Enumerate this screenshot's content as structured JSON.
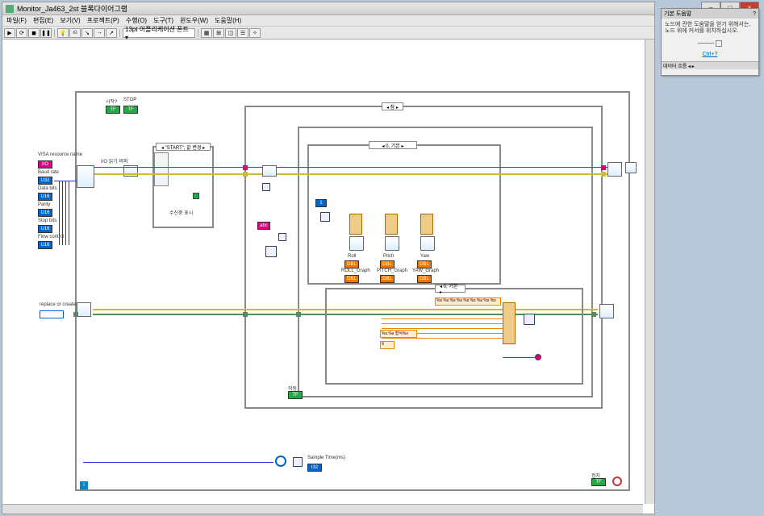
{
  "window": {
    "title": "Monitor_Ja463_2st 블록다이어그램"
  },
  "menu": [
    "파일(F)",
    "편집(E)",
    "보기(V)",
    "프로젝트(P)",
    "수행(O)",
    "도구(T)",
    "윈도우(W)",
    "도움말(H)"
  ],
  "fontselector": "13pt 어플리케이션 폰트 ▾",
  "help_panel": {
    "title": "기본 도움말",
    "line1": "노드에 관한 도움말을 얻기 위해서는,",
    "line2": "노드 위에 커서를 위치하십시오.",
    "morelink": "Ctrl+?"
  },
  "winbuttons": {
    "min": "–",
    "max": "□",
    "close": "×"
  },
  "labels": {
    "visa": "VISA resource name",
    "baud": "Baud rate",
    "databits": "Data bits",
    "parity": "Parity",
    "stopbits": "Stop bits",
    "flow": "Flow control",
    "start": "시작?",
    "stop": "STOP",
    "readbuf": "I/O 읽기 버퍼",
    "case_start": "◂  \"START\", 값 변경  ▸",
    "case_true": "◂  참  ▸",
    "case_default": "◂  0, 기본  ▸",
    "subtitle": "수신중 표시",
    "sampletime": "Sample Time(ms)",
    "roll": "Roll",
    "pitch": "Pitch",
    "yaw": "Yaw",
    "rollg": "ROLL_Graph",
    "pitchg": "PITCH_Graph",
    "yawg": "YAW_Graph",
    "replace": "replace or create",
    "running": "작동",
    "stopbtn": "정지",
    "fmt": "%s %s %s %s %s %s %s %s %s",
    "fname": "%s.%s 형식%s"
  },
  "helpfooter": "데이터 흐름  ◂  ▸"
}
